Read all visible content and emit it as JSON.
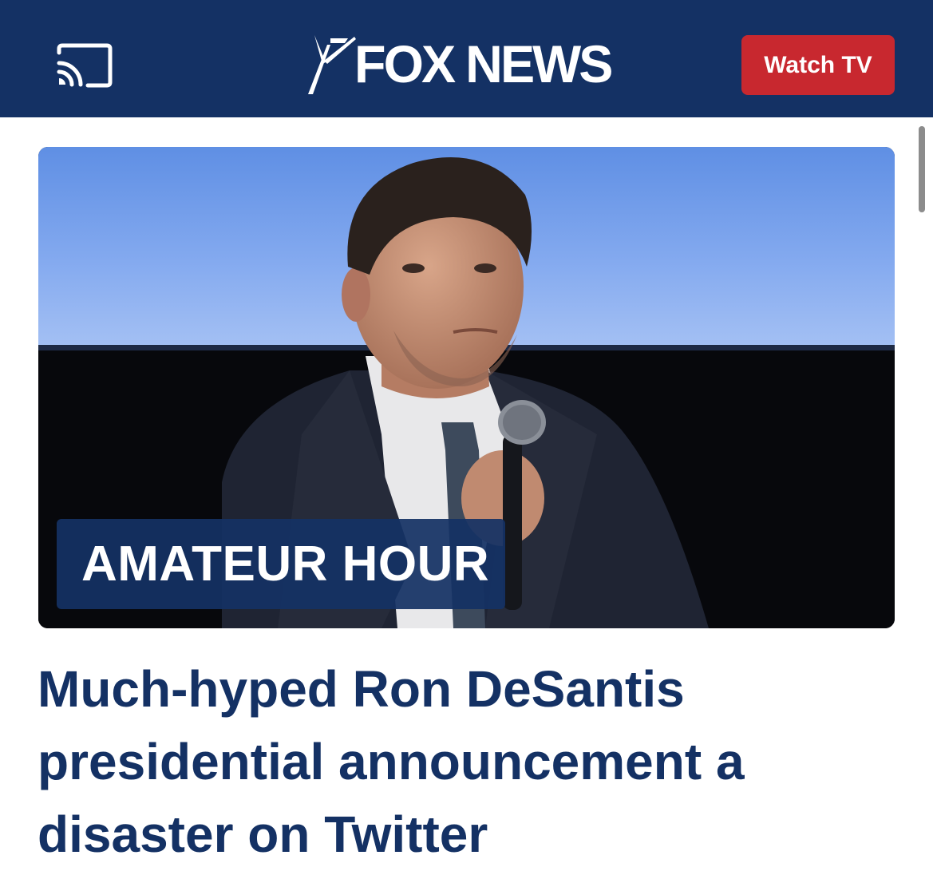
{
  "header": {
    "brand": "FOX NEWS",
    "watch_label": "Watch TV",
    "cast_icon": "cast-icon",
    "background_color": "#143164",
    "watch_color": "#c8282f"
  },
  "article": {
    "tag": "AMATEUR HOUR",
    "headline": "Much-hyped Ron DeSantis presidential announcement a disaster on Twitter",
    "image_description_icon": "photo-image",
    "headline_color": "#143164"
  }
}
